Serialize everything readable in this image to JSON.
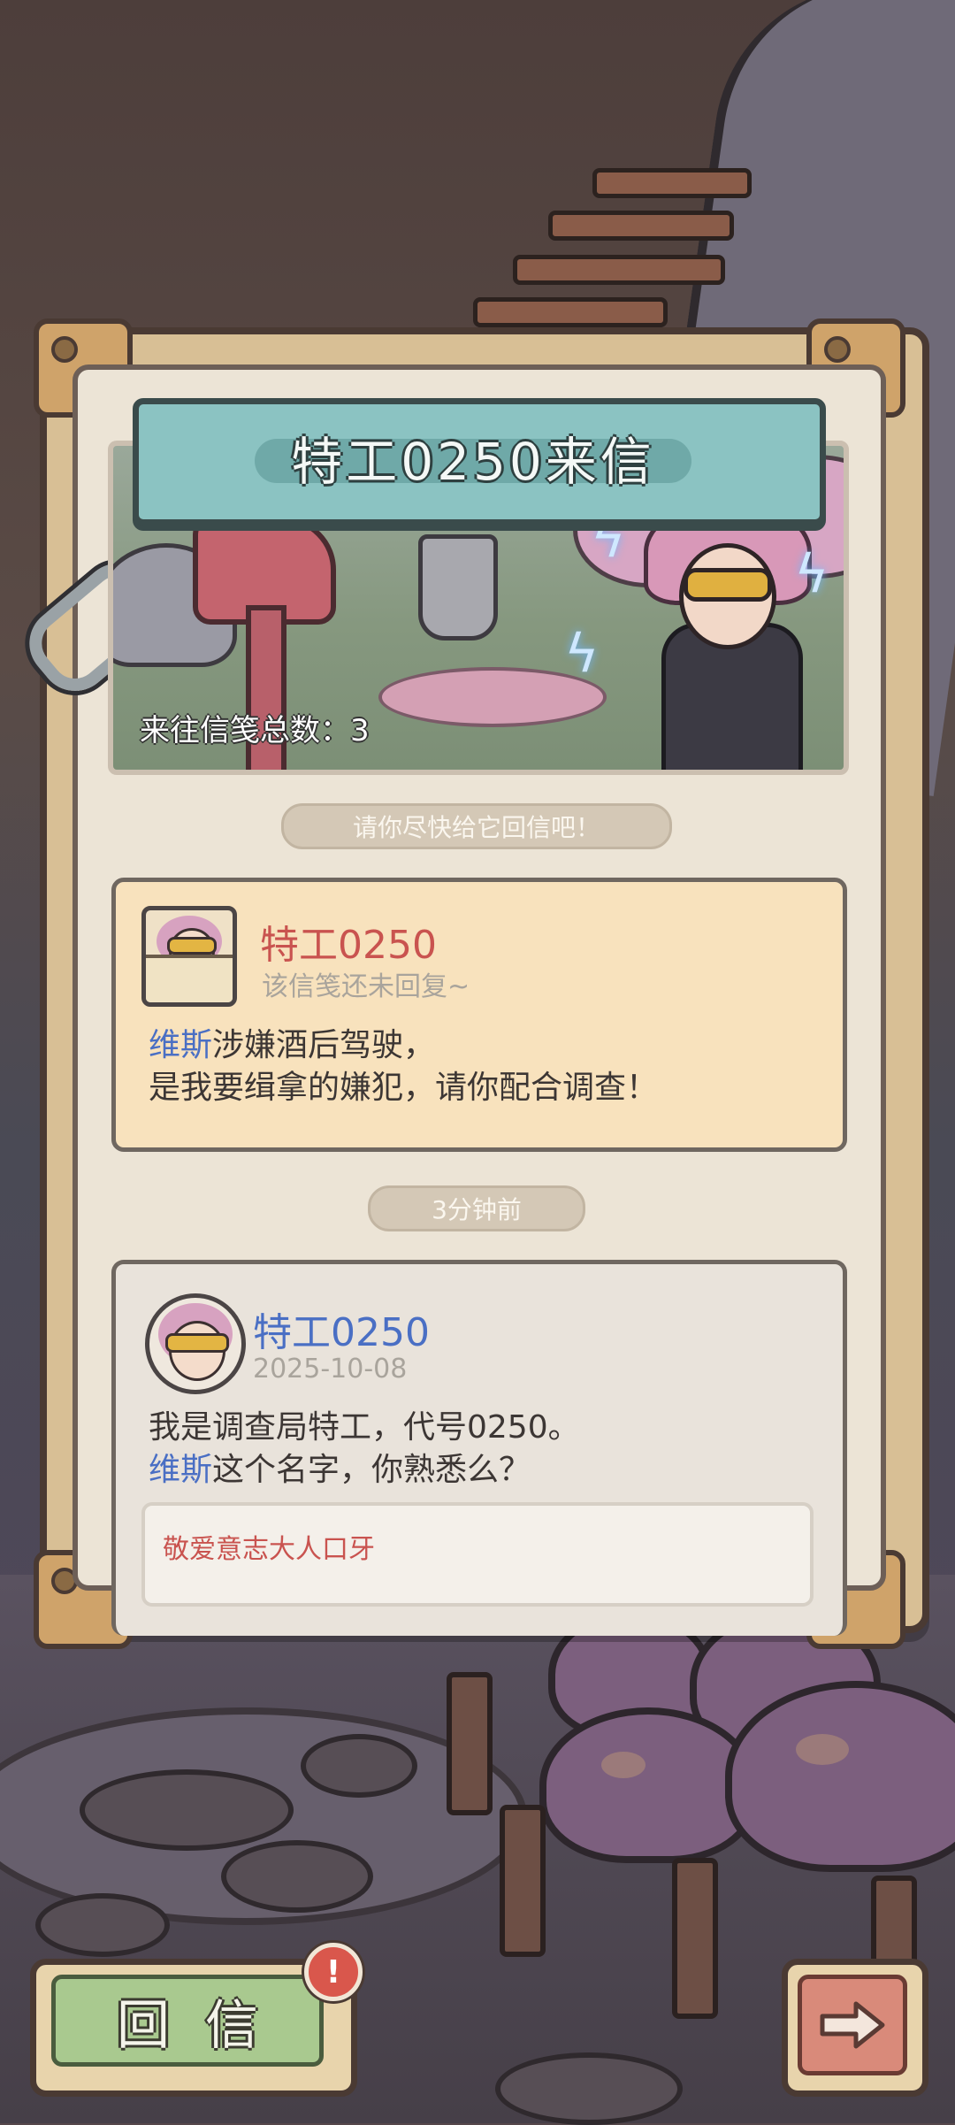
{
  "header": {
    "title": "特工0250来信"
  },
  "banner": {
    "letter_count": "来往信笺总数：3"
  },
  "prompt_pill": "请你尽快给它回信吧！",
  "card1": {
    "name": "特工0250",
    "status": "该信笺还未回复~",
    "line1_highlight": "维斯",
    "line1_rest": "涉嫌酒后驾驶，",
    "line2": "是我要缉拿的嫌犯，请你配合调查！"
  },
  "time_pill": "3分钟前",
  "card2": {
    "name": "特工0250",
    "date": "2025-10-08",
    "line1": "我是调查局特工，代号0250。",
    "line2_highlight": "维斯",
    "line2_rest": "这个名字，你熟悉么？",
    "quote": "敬爱意志大人口牙"
  },
  "buttons": {
    "reply_label": "回信",
    "reply_badge": "!",
    "next_icon": "arrow-right-icon"
  },
  "colors": {
    "name_red": "#c9534f",
    "name_blue": "#4a6fc4",
    "banner_teal": "#8bc3c2",
    "reply_green": "#a9c98f"
  }
}
